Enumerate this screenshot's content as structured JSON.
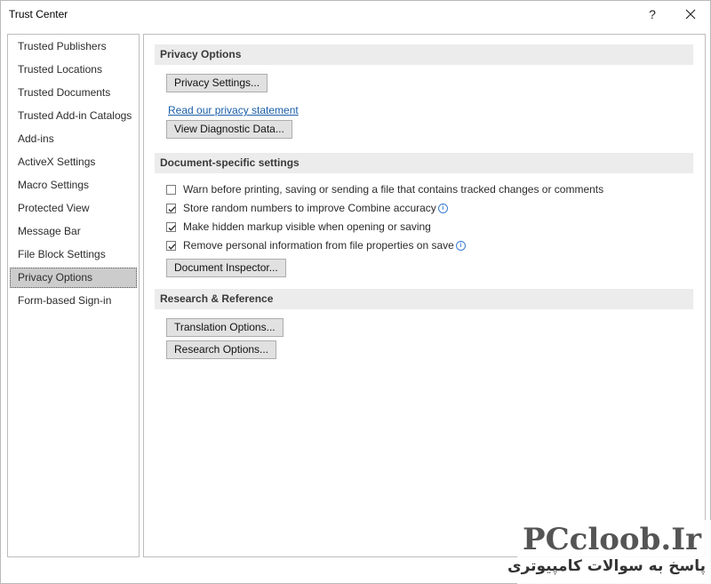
{
  "window": {
    "title": "Trust Center",
    "help_symbol": "?",
    "close_symbol": "✕"
  },
  "sidebar": {
    "items": [
      {
        "label": "Trusted Publishers"
      },
      {
        "label": "Trusted Locations"
      },
      {
        "label": "Trusted Documents"
      },
      {
        "label": "Trusted Add-in Catalogs"
      },
      {
        "label": "Add-ins"
      },
      {
        "label": "ActiveX Settings"
      },
      {
        "label": "Macro Settings"
      },
      {
        "label": "Protected View"
      },
      {
        "label": "Message Bar"
      },
      {
        "label": "File Block Settings"
      },
      {
        "label": "Privacy Options",
        "selected": true
      },
      {
        "label": "Form-based Sign-in"
      }
    ]
  },
  "privacy": {
    "heading": "Privacy Options",
    "settings_button": "Privacy Settings...",
    "statement_link": "Read our privacy statement",
    "diagnostic_button": "View Diagnostic Data..."
  },
  "document_settings": {
    "heading": "Document-specific settings",
    "options": [
      {
        "label": "Warn before printing, saving or sending a file that contains tracked changes or comments",
        "checked": false,
        "info": false
      },
      {
        "label": "Store random numbers to improve Combine accuracy",
        "checked": true,
        "info": true
      },
      {
        "label": "Make hidden markup visible when opening or saving",
        "checked": true,
        "info": false
      },
      {
        "label": "Remove personal information from file properties on save",
        "checked": true,
        "info": true
      }
    ],
    "inspector_button": "Document Inspector..."
  },
  "research": {
    "heading": "Research & Reference",
    "translation_button": "Translation Options...",
    "research_button": "Research Options..."
  },
  "watermark": {
    "main": "PCcloob.Ir",
    "sub": "پاسخ به سوالات کامپیوتری"
  },
  "icons": {
    "checkmark": "checkmark-icon",
    "info": "info-icon",
    "help": "question-mark-icon",
    "close": "close-icon"
  }
}
